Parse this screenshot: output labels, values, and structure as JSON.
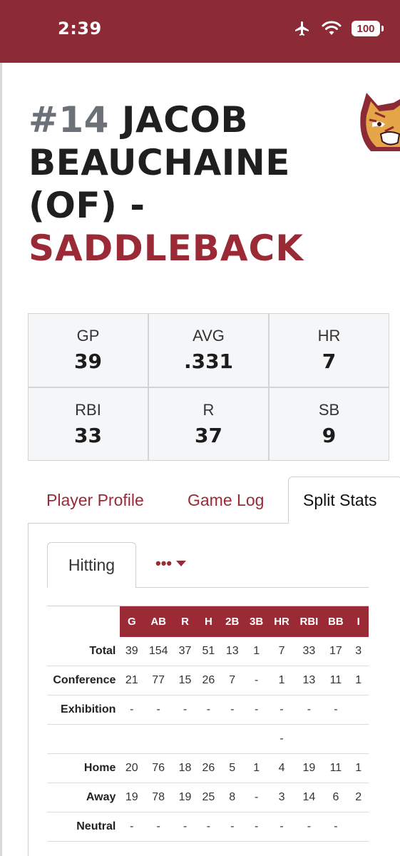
{
  "status_bar": {
    "time": "2:39",
    "battery": "100"
  },
  "player": {
    "number": "#14",
    "first_name": "JACOB",
    "last_name": "BEAUCHAINE",
    "position": "(OF) -",
    "team": "SADDLEBACK"
  },
  "summary_stats": [
    {
      "label": "GP",
      "value": "39"
    },
    {
      "label": "AVG",
      "value": ".331"
    },
    {
      "label": "HR",
      "value": "7"
    },
    {
      "label": "RBI",
      "value": "33"
    },
    {
      "label": "R",
      "value": "37"
    },
    {
      "label": "SB",
      "value": "9"
    }
  ],
  "tabs": [
    {
      "label": "Player Profile"
    },
    {
      "label": "Game Log"
    },
    {
      "label": "Split Stats"
    }
  ],
  "subtabs": {
    "active": "Hitting",
    "more": "•••"
  },
  "split_table": {
    "columns": [
      "G",
      "AB",
      "R",
      "H",
      "2B",
      "3B",
      "HR",
      "RBI",
      "BB",
      "I"
    ],
    "rows": [
      {
        "label": "Total",
        "cells": [
          "39",
          "154",
          "37",
          "51",
          "13",
          "1",
          "7",
          "33",
          "17",
          "3"
        ]
      },
      {
        "label": "Conference",
        "cells": [
          "21",
          "77",
          "15",
          "26",
          "7",
          "-",
          "1",
          "13",
          "11",
          "1"
        ]
      },
      {
        "label": "Exhibition",
        "cells": [
          "-",
          "-",
          "-",
          "-",
          "-",
          "-",
          "-",
          "-",
          "-",
          ""
        ]
      },
      {
        "label": "",
        "cells": [
          "",
          "",
          "",
          "",
          "",
          "",
          "-",
          "",
          "",
          ""
        ]
      },
      {
        "label": "Home",
        "cells": [
          "20",
          "76",
          "18",
          "26",
          "5",
          "1",
          "4",
          "19",
          "11",
          "1"
        ]
      },
      {
        "label": "Away",
        "cells": [
          "19",
          "78",
          "19",
          "25",
          "8",
          "-",
          "3",
          "14",
          "6",
          "2"
        ]
      },
      {
        "label": "Neutral",
        "cells": [
          "-",
          "-",
          "-",
          "-",
          "-",
          "-",
          "-",
          "-",
          "-",
          ""
        ]
      }
    ]
  },
  "colors": {
    "brand": "#8c2a35",
    "accent": "#9a2b36",
    "muted_number": "#6b7176"
  }
}
